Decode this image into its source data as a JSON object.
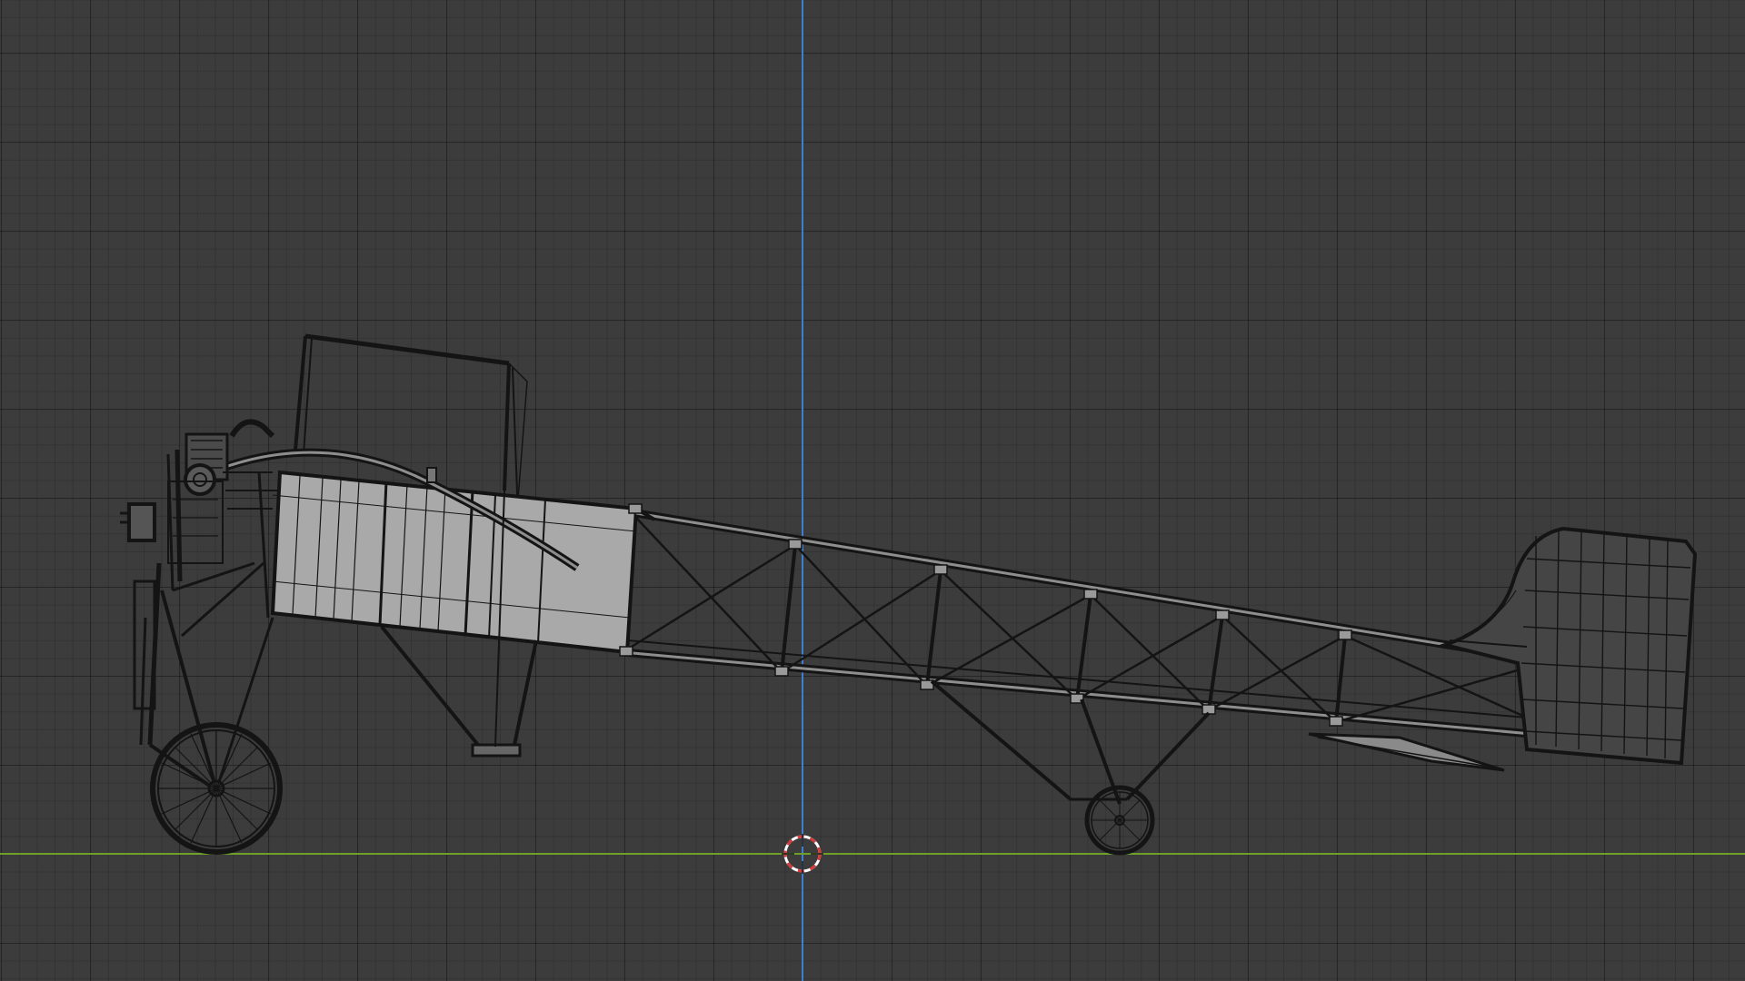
{
  "viewport": {
    "view": "side-orthographic",
    "object": "monoplane-wireframe",
    "colors": {
      "background": "#3c3c3c",
      "grid": "#2b2b2b",
      "z_axis": "#3f7fd1",
      "x_axis": "#6ea02a",
      "wire": "#141414",
      "fill": "#a9a9a9",
      "cursor_red": "#d43a3a",
      "cursor_white": "#ffffff"
    }
  }
}
